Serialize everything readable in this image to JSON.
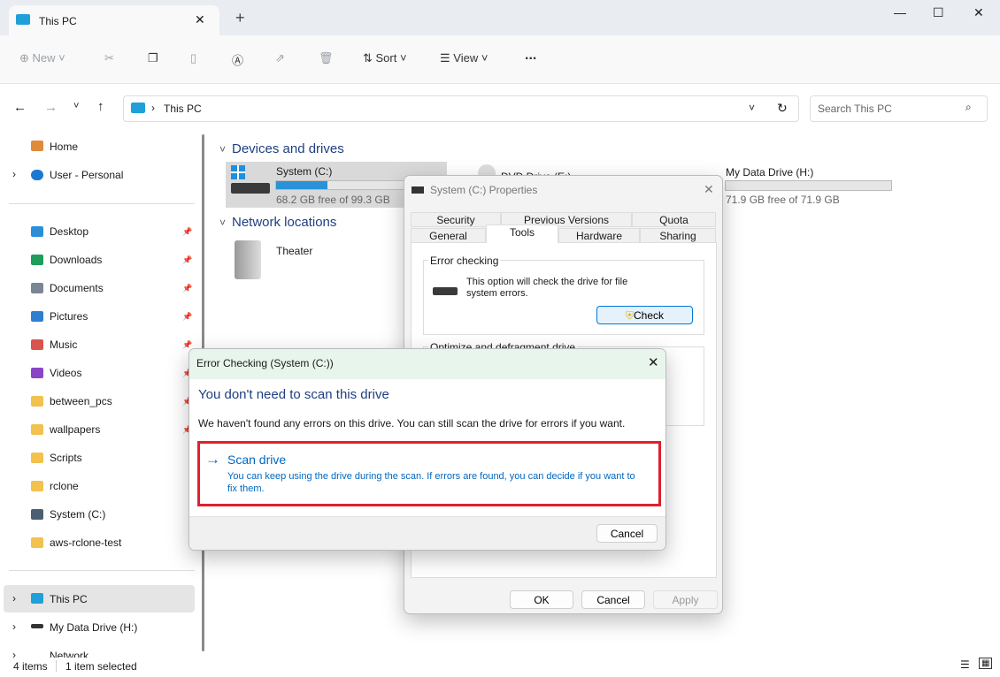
{
  "window": {
    "tab_title": "This PC",
    "new_tab": "+"
  },
  "toolbar": {
    "new": "New",
    "sort": "Sort",
    "view": "View",
    "more": "..."
  },
  "address": {
    "path": "This PC",
    "search_placeholder": "Search This PC"
  },
  "sidebar": {
    "top": [
      {
        "label": "Home"
      },
      {
        "label": "User - Personal"
      }
    ],
    "items": [
      {
        "label": "Desktop",
        "color": "#2a8fd8",
        "pinned": true
      },
      {
        "label": "Downloads",
        "color": "#1e9e5a",
        "pinned": true
      },
      {
        "label": "Documents",
        "color": "#7a8694",
        "pinned": true
      },
      {
        "label": "Pictures",
        "color": "#2f7fd0",
        "pinned": true
      },
      {
        "label": "Music",
        "color": "#d9534f",
        "pinned": true
      },
      {
        "label": "Videos",
        "color": "#8a44c8",
        "pinned": true
      },
      {
        "label": "between_pcs",
        "color": "#f2c14e",
        "pinned": true
      },
      {
        "label": "wallpapers",
        "color": "#f2c14e",
        "pinned": true
      },
      {
        "label": "Scripts",
        "color": "#f2c14e",
        "pinned": false
      },
      {
        "label": "rclone",
        "color": "#f2c14e",
        "pinned": false
      },
      {
        "label": "System (C:)",
        "color": "#4a6072",
        "pinned": false
      },
      {
        "label": "aws-rclone-test",
        "color": "#f2c14e",
        "pinned": false
      }
    ],
    "bottom": [
      {
        "label": "This PC",
        "selected": true
      },
      {
        "label": "My Data Drive (H:)"
      },
      {
        "label": "Network"
      }
    ]
  },
  "content": {
    "devices_header": "Devices and drives",
    "network_header": "Network locations",
    "drives": [
      {
        "name": "System (C:)",
        "free": "68.2 GB free of 99.3 GB",
        "used_fraction": 0.31
      },
      {
        "name": "DVD Drive (E:)"
      },
      {
        "name": "My Data Drive (H:)",
        "free": "71.9 GB free of 71.9 GB",
        "used_fraction": 0.0
      }
    ],
    "network": [
      {
        "name": "Theater"
      }
    ]
  },
  "status": {
    "items": "4 items",
    "selected": "1 item selected"
  },
  "properties": {
    "title": "System (C:) Properties",
    "tabs_row1": [
      "Security",
      "Previous Versions",
      "Quota"
    ],
    "tabs_row2": [
      "General",
      "Tools",
      "Hardware",
      "Sharing"
    ],
    "active_tab": "Tools",
    "error_group": "Error checking",
    "error_text": "This option will check the drive for file system errors.",
    "check": "Check",
    "optimize_group": "Optimize and defragment drive",
    "ok": "OK",
    "cancel": "Cancel",
    "apply": "Apply"
  },
  "error_dialog": {
    "title": "Error Checking (System (C:))",
    "heading": "You don't need to scan this drive",
    "message": "We haven't found any errors on this drive. You can still scan the drive for errors if you want.",
    "scan_title": "Scan drive",
    "scan_desc": "You can keep using the drive during the scan. If errors are found, you can decide if you want to fix them.",
    "cancel": "Cancel",
    "highlight_color": "#e0202c",
    "accent": "#0067c0"
  }
}
